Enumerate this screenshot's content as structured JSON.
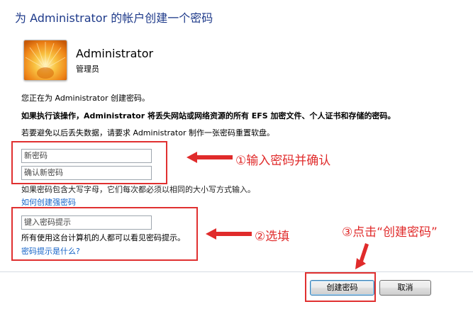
{
  "header": {
    "title": "为 Administrator 的帐户创建一个密码"
  },
  "account": {
    "name": "Administrator",
    "role": "管理员",
    "avatar_icon": "flower-avatar-icon"
  },
  "info": {
    "line1": "您正在为 Administrator 创建密码。",
    "line2": "如果执行该操作，Administrator 将丢失网站或网络资源的所有 EFS 加密文件、个人证书和存储的密码。",
    "line3": "若要避免以后丢失数据，请要求 Administrator 制作一张密码重置软盘。"
  },
  "form": {
    "new_password_placeholder": "新密码",
    "confirm_password_placeholder": "确认新密码",
    "case_note": "如果密码包含大写字母，它们每次都必须以相同的大小写方式输入。",
    "strong_password_link": "如何创建强密码",
    "hint_placeholder": "键入密码提示",
    "hint_note": "所有使用这台计算机的人都可以看见密码提示。",
    "hint_link": "密码提示是什么?"
  },
  "buttons": {
    "create": "创建密码",
    "cancel": "取消"
  },
  "annotations": {
    "step1": "①输入密码并确认",
    "step2": "②选填",
    "step3": "③点击“创建密码”",
    "color": "#e02b2b"
  }
}
